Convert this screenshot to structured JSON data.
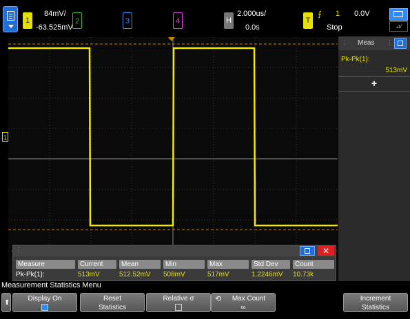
{
  "top": {
    "channels": [
      {
        "num": "1",
        "scale": "84mV/",
        "offset": "-63.525mV"
      },
      {
        "num": "2"
      },
      {
        "num": "3"
      },
      {
        "num": "4"
      }
    ],
    "horizontal": {
      "label": "H",
      "scale": "2.000us/",
      "delay": "0.0s"
    },
    "trigger": {
      "label": "T",
      "slope": "⨍",
      "source": "1",
      "level": "0.0V",
      "mode": "Stop"
    },
    "display_toggle": "⊿⁄"
  },
  "side": {
    "title": "Meas",
    "measurements": [
      {
        "name": "Pk-Pk(1):",
        "value": "513mV"
      }
    ],
    "add": "+"
  },
  "stats": {
    "headers": [
      "Measure",
      "Current",
      "Mean",
      "Min",
      "Max",
      "Std Dev",
      "Count"
    ],
    "row": [
      "Pk-Pk(1):",
      "513mV",
      "512.52mV",
      "508mV",
      "517mV",
      "1.2246mV",
      "10.73k"
    ],
    "close": "✕"
  },
  "menu": {
    "title": "Measurement Statistics Menu",
    "softkeys": [
      {
        "l1": "Display On",
        "checkbox": true,
        "checked": true
      },
      {
        "l1": "Reset",
        "l2": "Statistics"
      },
      {
        "l1": "Relative σ",
        "checkbox": true,
        "checked": false
      },
      {
        "l1": "Max Count",
        "l2": "∞",
        "icon": "rotary-knob-icon"
      },
      {
        "l1": "Increment",
        "l2": "Statistics"
      }
    ]
  },
  "colors": {
    "ch1": "#e8e000",
    "ch2": "#1fc21f",
    "ch3": "#3a8cff",
    "ch4": "#e33ee3",
    "accent": "#1e6fd9"
  }
}
